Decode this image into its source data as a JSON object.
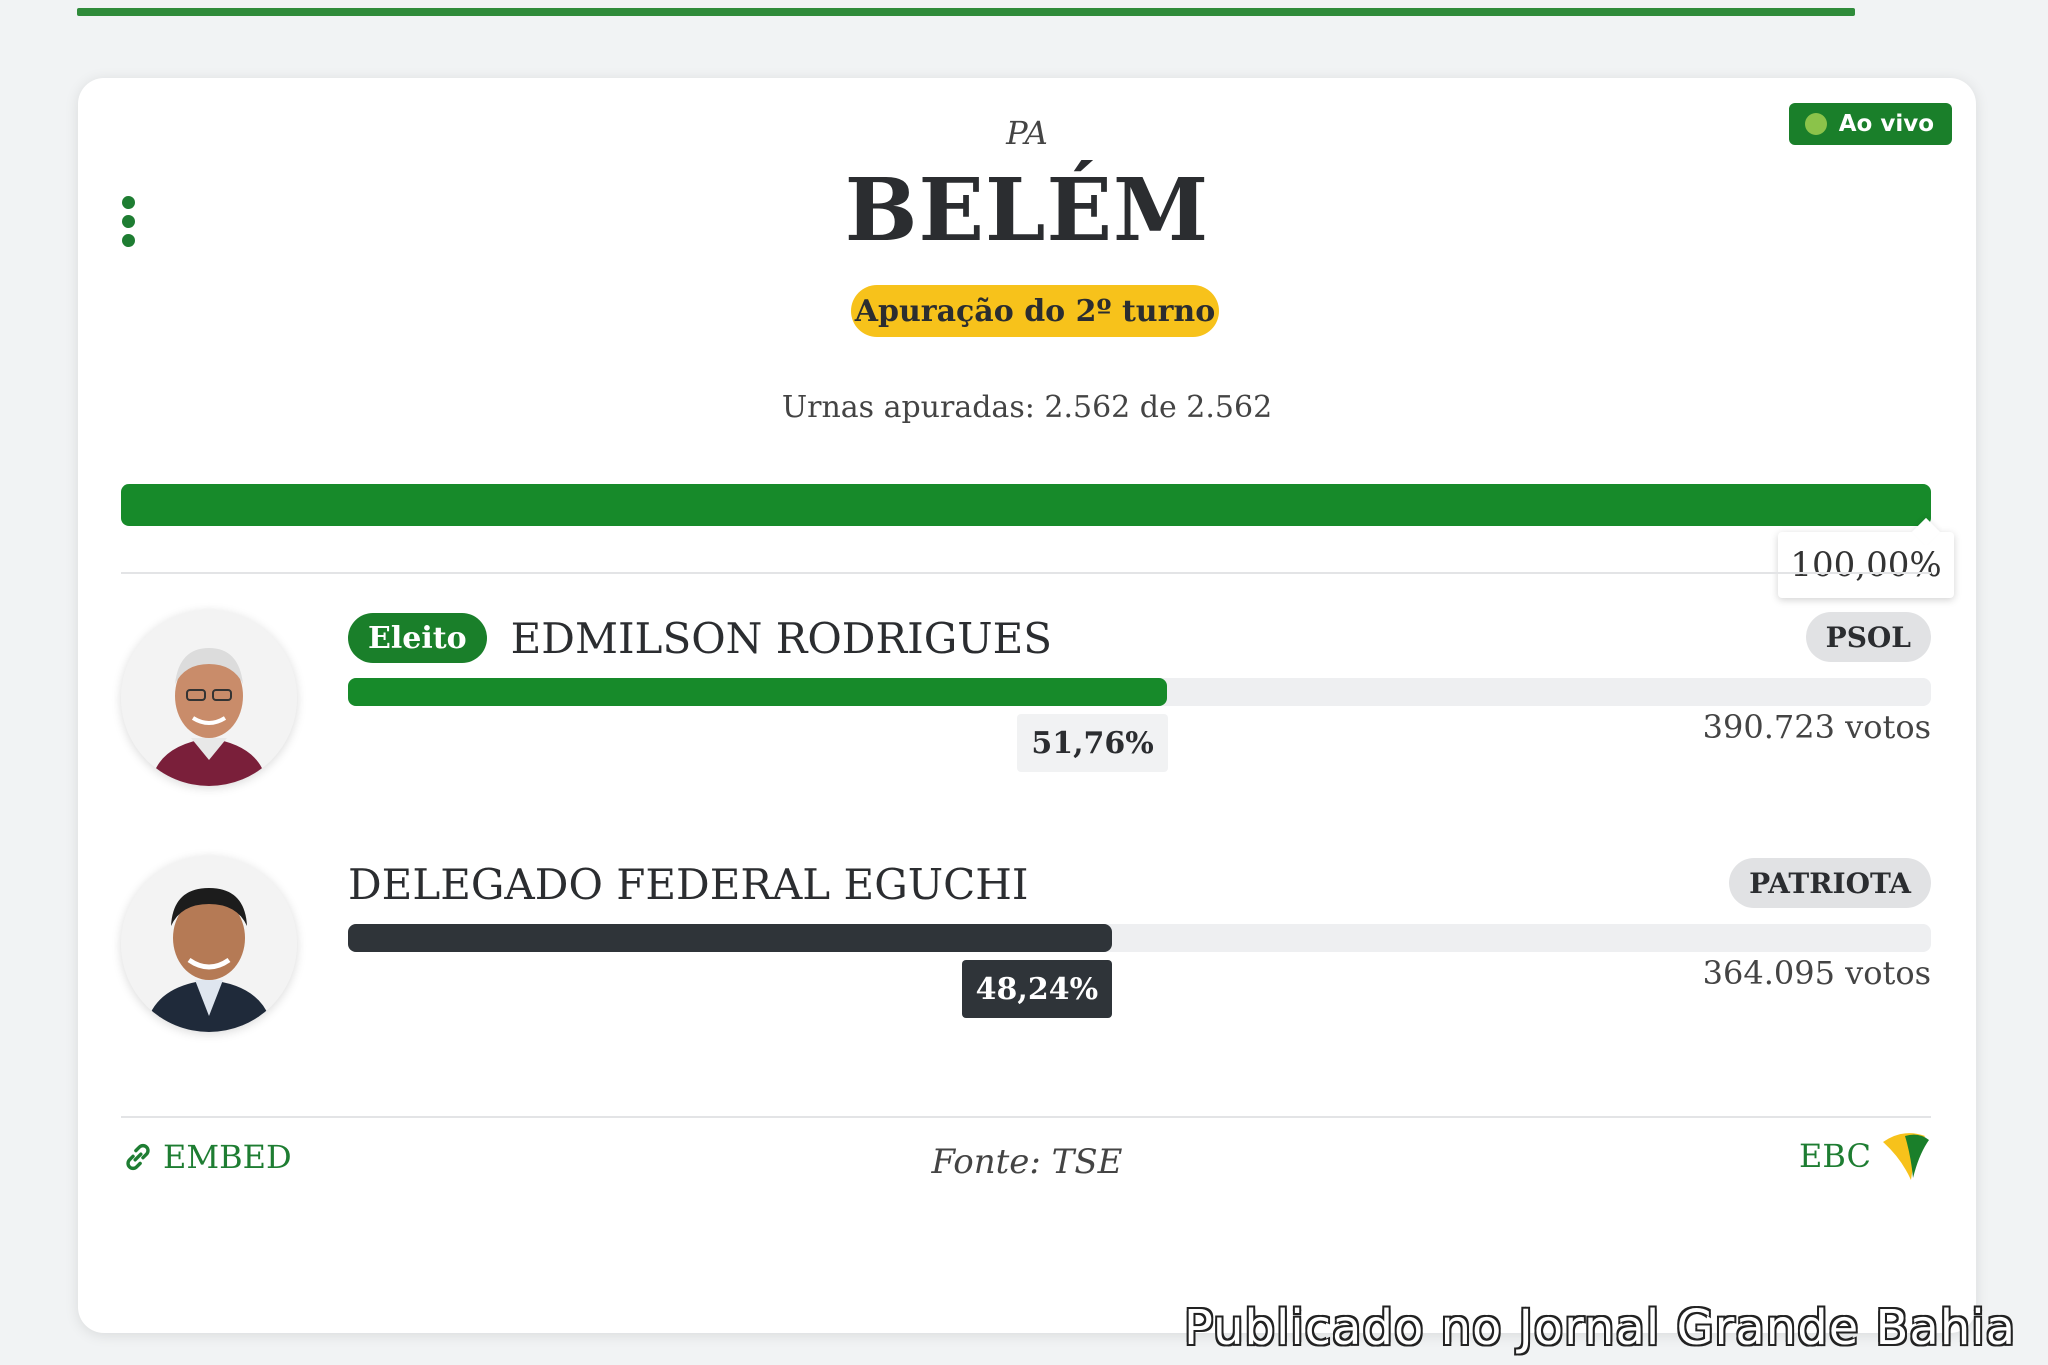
{
  "header": {
    "state": "PA",
    "city": "BELÉM",
    "round_label": "Apuração do 2º turno",
    "live_label": "Ao vivo",
    "menu_icon": "kebab-menu-icon"
  },
  "counting": {
    "urnas_text": "Urnas apuradas: 2.562 de 2.562",
    "progress_percent": 100,
    "progress_label": "100,00%"
  },
  "candidates": [
    {
      "elected_label": "Eleito",
      "name": "EDMILSON RODRIGUES",
      "party": "PSOL",
      "percent": 51.76,
      "percent_label": "51,76%",
      "votes_label": "390.723 votos",
      "bar_color": "#178a2a",
      "label_bg": "#f1f2f3",
      "label_fg": "#2b2d30"
    },
    {
      "elected_label": "",
      "name": "DELEGADO FEDERAL EGUCHI",
      "party": "PATRIOTA",
      "percent": 48.24,
      "percent_label": "48,24%",
      "votes_label": "364.095 votos",
      "bar_color": "#2f3439",
      "label_bg": "#2f3439",
      "label_fg": "#ffffff"
    }
  ],
  "footer": {
    "embed_label": "EMBED",
    "source_label": "Fonte: TSE",
    "brand_label": "EBC"
  },
  "watermark": "Publicado no Jornal Grande Bahia",
  "colors": {
    "accent_green": "#1a7f2a",
    "progress_green": "#178a2a",
    "round_yellow": "#f7c21b"
  }
}
